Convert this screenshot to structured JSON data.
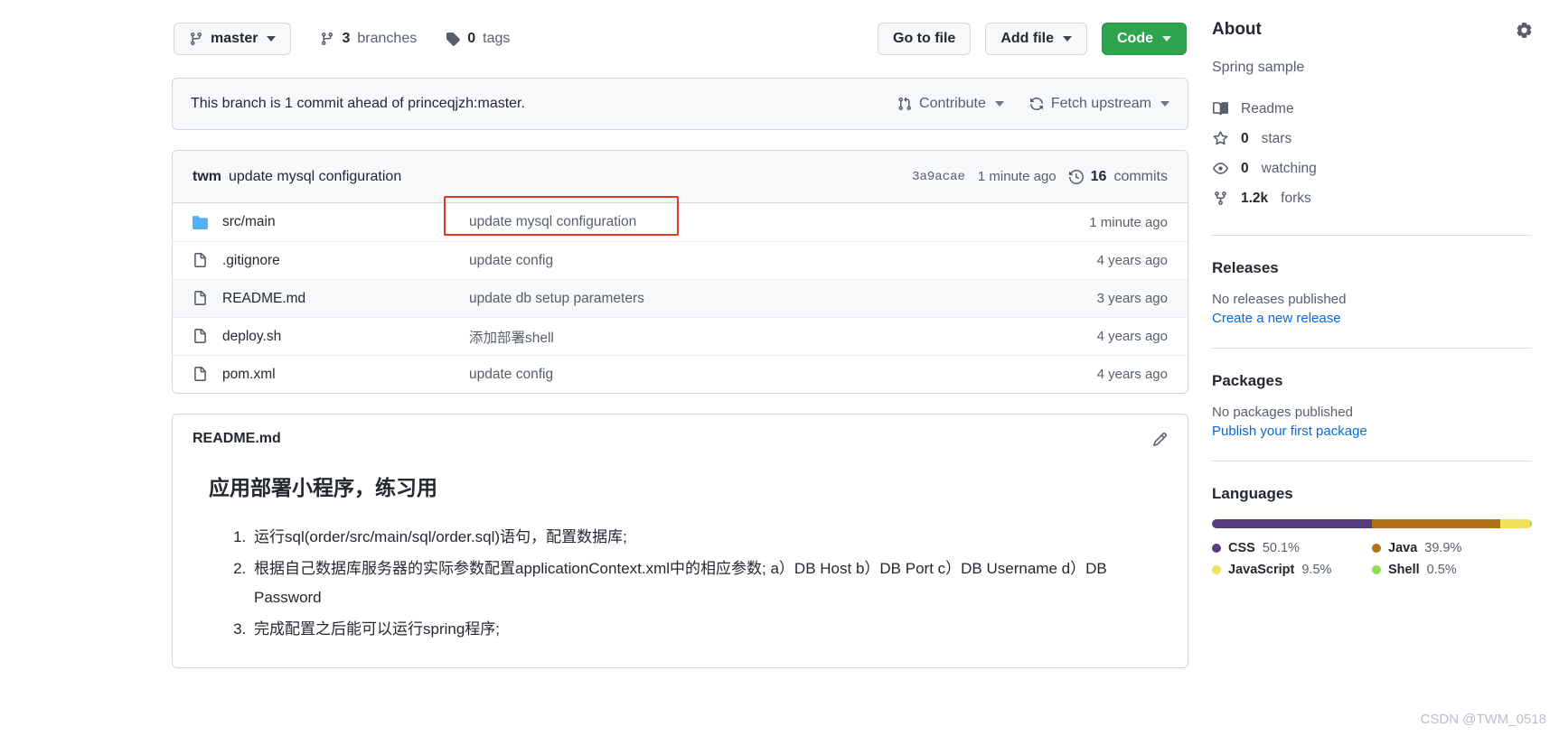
{
  "toolbar": {
    "branch_button": "master",
    "branches_count": "3",
    "branches_label": "branches",
    "tags_count": "0",
    "tags_label": "tags",
    "go_to_file": "Go to file",
    "add_file": "Add file",
    "code": "Code"
  },
  "notice": {
    "text": "This branch is 1 commit ahead of princeqjzh:master.",
    "contribute": "Contribute",
    "fetch_upstream": "Fetch upstream"
  },
  "commit_header": {
    "author": "twm",
    "message": "update mysql configuration",
    "sha": "3a9acae",
    "time": "1 minute ago",
    "commits_count": "16",
    "commits_label": "commits"
  },
  "files": [
    {
      "name": "src/main",
      "type": "folder",
      "message": "update mysql configuration",
      "time": "1 minute ago",
      "highlighted": true
    },
    {
      "name": ".gitignore",
      "type": "file",
      "message": "update config",
      "time": "4 years ago",
      "highlighted": false
    },
    {
      "name": "README.md",
      "type": "file",
      "message": "update db setup parameters",
      "time": "3 years ago",
      "highlighted": false
    },
    {
      "name": "deploy.sh",
      "type": "file",
      "message": "添加部署shell",
      "time": "4 years ago",
      "highlighted": false
    },
    {
      "name": "pom.xml",
      "type": "file",
      "message": "update config",
      "time": "4 years ago",
      "highlighted": false
    }
  ],
  "readme": {
    "title": "README.md",
    "heading": "应用部署小程序，练习用",
    "items": [
      "运行sql(order/src/main/sql/order.sql)语句，配置数据库;",
      "根据自己数据库服务器的实际参数配置applicationContext.xml中的相应参数; a）DB Host b）DB Port c）DB Username d）DB Password",
      "完成配置之后能可以运行spring程序;"
    ]
  },
  "about": {
    "title": "About",
    "description": "Spring sample",
    "stats": [
      {
        "icon": "book-icon",
        "value": "",
        "label": "Readme"
      },
      {
        "icon": "star-icon",
        "value": "0",
        "label": "stars"
      },
      {
        "icon": "eye-icon",
        "value": "0",
        "label": "watching"
      },
      {
        "icon": "fork-icon",
        "value": "1.2k",
        "label": "forks"
      }
    ]
  },
  "releases": {
    "title": "Releases",
    "note": "No releases published",
    "link": "Create a new release"
  },
  "packages": {
    "title": "Packages",
    "note": "No packages published",
    "link": "Publish your first package"
  },
  "languages": {
    "title": "Languages",
    "items": [
      {
        "name": "CSS",
        "percent": "50.1%",
        "color": "#563d7c",
        "width": 50.1
      },
      {
        "name": "Java",
        "percent": "39.9%",
        "color": "#b07219",
        "width": 39.9
      },
      {
        "name": "JavaScript",
        "percent": "9.5%",
        "color": "#f1e05a",
        "width": 9.5
      },
      {
        "name": "Shell",
        "percent": "0.5%",
        "color": "#89e051",
        "width": 0.5
      }
    ]
  },
  "watermark": "CSDN @TWM_0518",
  "colors": {
    "green": "#2da44e",
    "link": "#0969da",
    "muted": "#57606a",
    "highlight": "#e5352b"
  }
}
